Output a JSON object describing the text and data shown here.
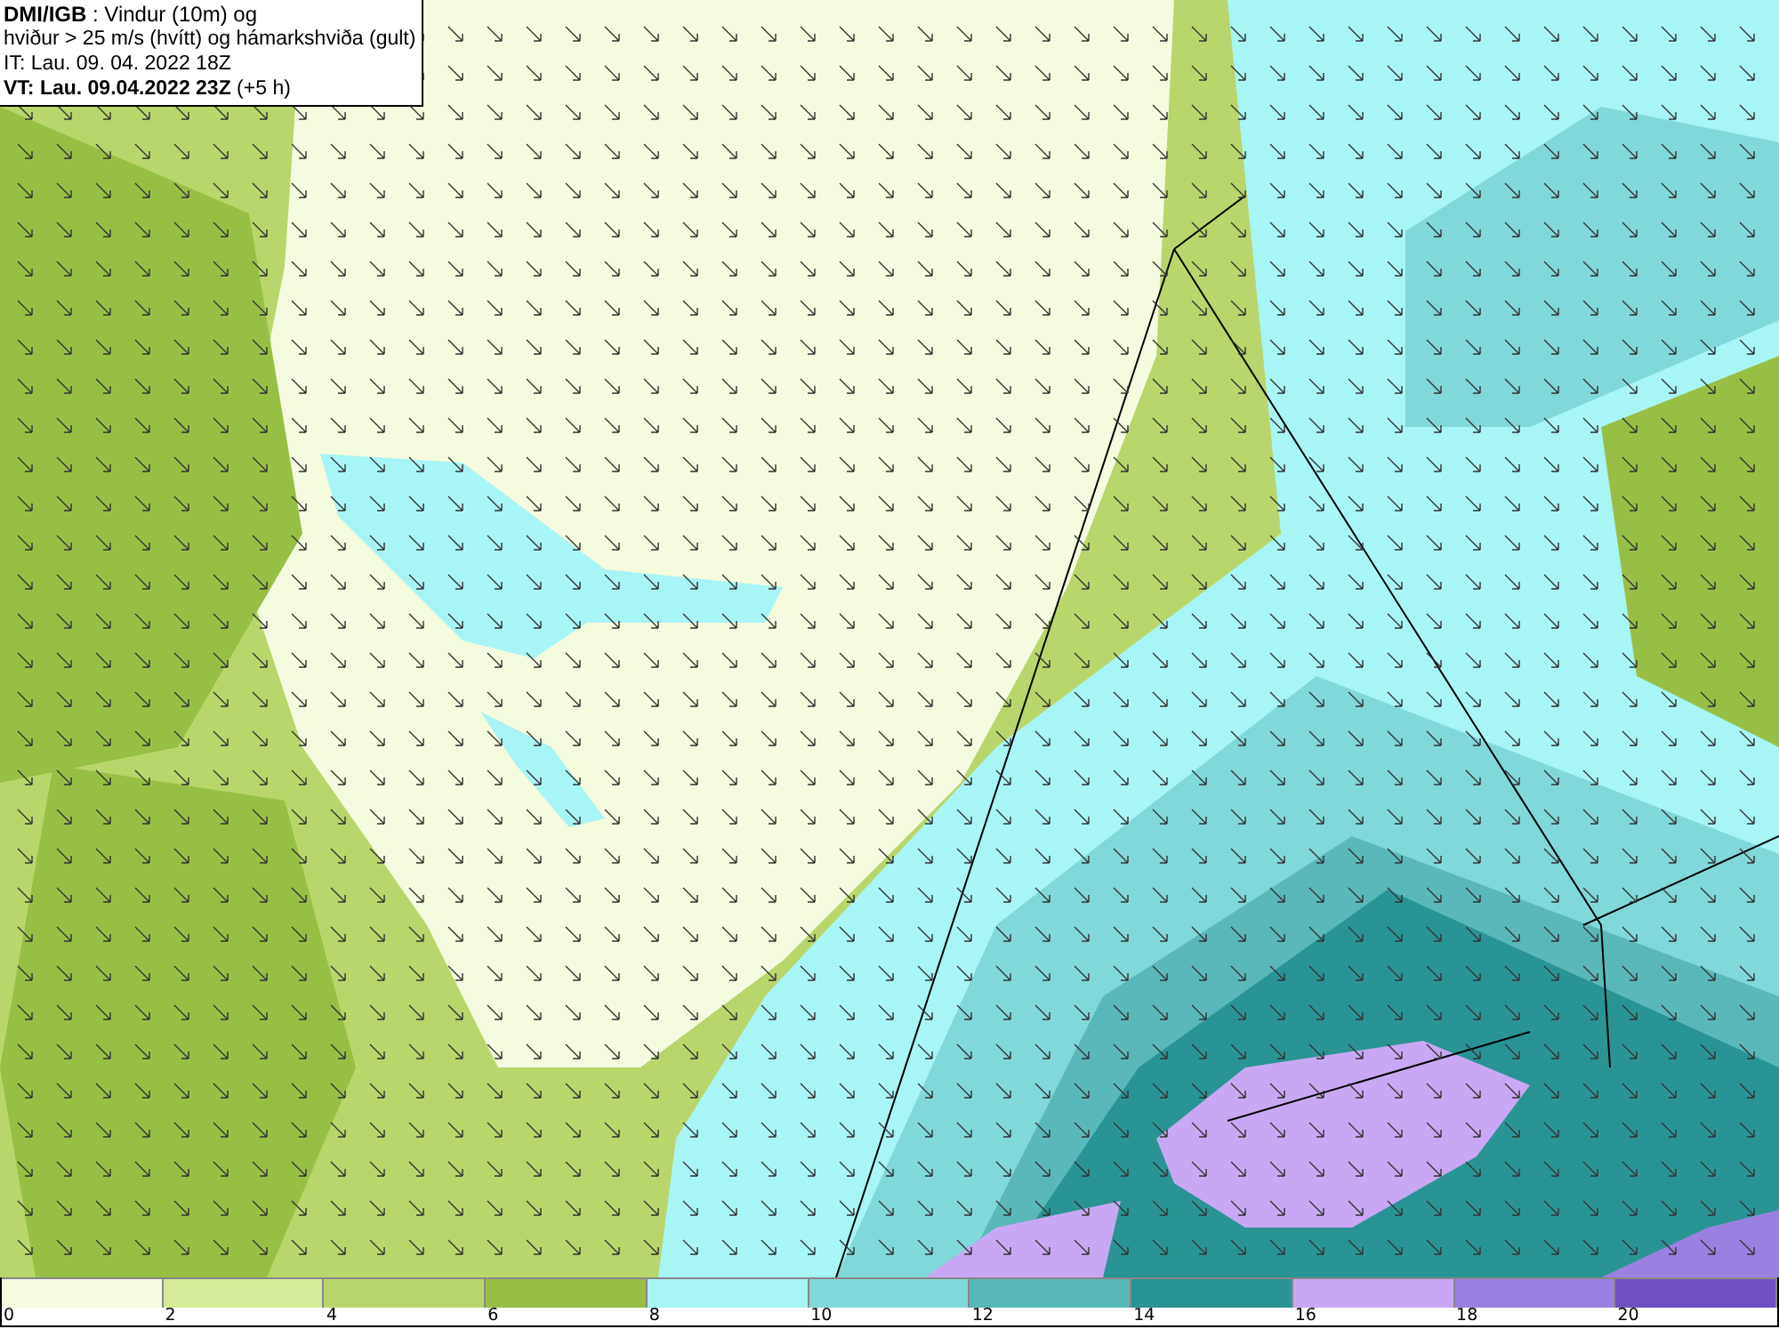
{
  "title_box": {
    "lines": [
      "**DMI/IGB** : Vindur (10m) og",
      "hviður > 25 m/s (hvítt) og hámarkshviða (gult)",
      "IT: Lau. 09. 04. 2022 18Z",
      "**VT: Lau. 09.04.2022 23Z** (+5 h)"
    ]
  },
  "legend": [
    {
      "label": "0",
      "color": "#f5fbde"
    },
    {
      "label": "2",
      "color": "#d6eb9a"
    },
    {
      "label": "4",
      "color": "#b8d66b"
    },
    {
      "label": "6",
      "color": "#98bf45"
    },
    {
      "label": "8",
      "color": "#a8f5f5"
    },
    {
      "label": "10",
      "color": "#80d8d8"
    },
    {
      "label": "12",
      "color": "#5ab8b8"
    },
    {
      "label": "14",
      "color": "#2a9494"
    },
    {
      "label": "16",
      "color": "#c8a8f5"
    },
    {
      "label": "18",
      "color": "#9a80e0"
    },
    {
      "label": "20",
      "color": "#7050c0"
    }
  ]
}
